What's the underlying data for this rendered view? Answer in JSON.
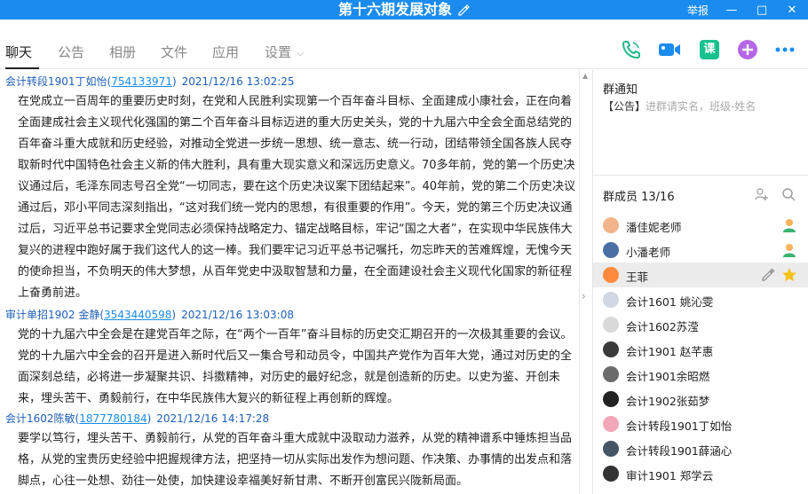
{
  "titlebar": {
    "title": "第十六期发展对象",
    "report": "举报",
    "min": "—",
    "max": "□",
    "close": "✕"
  },
  "tabs": [
    {
      "label": "聊天"
    },
    {
      "label": "公告"
    },
    {
      "label": "相册"
    },
    {
      "label": "文件"
    },
    {
      "label": "应用"
    },
    {
      "label": "设置"
    }
  ],
  "toolbar": {
    "course_label": "课",
    "colors": {
      "phone": "#23b98a",
      "video": "#1a8cf0",
      "course": "#19c18f",
      "add": "#b466e6",
      "more": "#1a8cf0"
    }
  },
  "messages": [
    {
      "sender": "会计转段1901丁如怡(",
      "qq": "754133971",
      "close": ")",
      "time": "2021/12/16 13:02:25",
      "body": "在党成立一百周年的重要历史时刻，在党和人民胜利实现第一个百年奋斗目标、全面建成小康社会，正在向着全面建成社会主义现代化强国的第二个百年奋斗目标迈进的重大历史关头，党的十九届六中全会全面总结党的百年奋斗重大成就和历史经验，对推动全党进一步统一思想、统一意志、统一行动，团结带领全国各族人民夺取新时代中国特色社会主义新的伟大胜利，具有重大现实意义和深远历史意义。70多年前，党的第一个历史决议通过后，毛泽东同志号召全党“一切同志，要在这个历史决议案下团结起来”。40年前，党的第二个历史决议通过后，邓小平同志深刻指出，“这对我们统一党内的思想，有很重要的作用”。今天，党的第三个历史决议通过后，习近平总书记要求全党同志必须保持战略定力、锚定战略目标，牢记“国之大者”，在实现中华民族伟大复兴的进程中跑好属于我们这代人的这一棒。我们要牢记习近平总书记嘱托，勿忘昨天的苦难辉煌，无愧今天的使命担当，不负明天的伟大梦想，从百年党史中汲取智慧和力量，在全面建设社会主义现代化国家的新征程上奋勇前进。"
    },
    {
      "sender": "审计单招1902 金静(",
      "qq": "3543440598",
      "close": ")",
      "time": "2021/12/16 13:03:08",
      "body": "党的十九届六中全会是在建党百年之际，在“两个一百年”奋斗目标的历史交汇期召开的一次极其重要的会议。党的十九届六中全会的召开是进入新时代后又一集合号和动员令，中国共产党作为百年大党，通过对历史的全面深刻总结，必将进一步凝聚共识、抖擞精神，对历史的最好纪念，就是创造新的历史。以史为鉴、开创未来，埋头苦干、勇毅前行，在中华民族伟大复兴的新征程上再创新的辉煌。"
    },
    {
      "sender": "会计1602陈敏(",
      "qq": "1877780184",
      "close": ")",
      "time": "2021/12/16 14:17:28",
      "body": "要学以笃行，埋头苦干、勇毅前行，从党的百年奋斗重大成就中汲取动力滋养，从党的精神谱系中锤炼担当品格，从党的宝贵历史经验中把握规律方法，把坚持一切从实际出发作为想问题、作决策、办事情的出发点和落脚点，心往一处想、劲往一处使，加快建设幸福美好新甘肃、不断开创富民兴陇新局面。"
    }
  ],
  "notice": {
    "title": "群通知",
    "tag": "【公告】",
    "text": "进群请实名，班级-姓名"
  },
  "members": {
    "title": "群成员 13/16",
    "list": [
      {
        "name": "潘佳妮老师",
        "badge": "admin",
        "avatar_color": "#f2b48a"
      },
      {
        "name": "小潘老师",
        "badge": "admin",
        "avatar_color": "#4a6fa5"
      },
      {
        "name": "王菲",
        "badge": "owner",
        "avatar_color": "#ff8a3d"
      },
      {
        "name": "会计1601 姚沁雯",
        "badge": "",
        "avatar_color": "#cfd8e3"
      },
      {
        "name": "会计1602苏滢",
        "badge": "",
        "avatar_color": "#d9d9d9"
      },
      {
        "name": "会计1901 赵芊惠",
        "badge": "",
        "avatar_color": "#3a3a3a"
      },
      {
        "name": "会计1901余昭燃",
        "badge": "",
        "avatar_color": "#6b6b6b"
      },
      {
        "name": "会计1902张茹梦",
        "badge": "",
        "avatar_color": "#222222"
      },
      {
        "name": "会计转段1901丁如怡",
        "badge": "",
        "avatar_color": "#f2a7b8"
      },
      {
        "name": "会计转段1901薛涵心",
        "badge": "",
        "avatar_color": "#445566"
      },
      {
        "name": "审计1901 郑学云",
        "badge": "",
        "avatar_color": "#333333"
      }
    ]
  }
}
